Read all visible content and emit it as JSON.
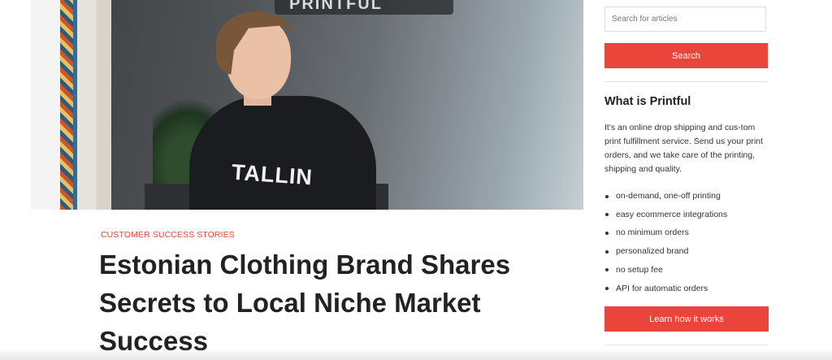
{
  "article": {
    "category": "CUSTOMER SUCCESS STORIES",
    "title": "Estonian Clothing Brand Shares Secrets to Local Niche Market Success",
    "hero": {
      "sign_text": "PRINTFUL",
      "shirt_text": "TALLIN"
    }
  },
  "sidebar": {
    "search": {
      "placeholder": "Search for articles",
      "button_label": "Search"
    },
    "info": {
      "title": "What is Printful",
      "description": "It's an online drop shipping and cus-tom print fulfillment service. Send us your print orders, and we take care of the printing, shipping and quality.",
      "features": [
        "on-demand, one-off printing",
        "easy ecommerce integrations",
        "no minimum orders",
        "personalized brand",
        "no setup fee",
        "API for automatic orders"
      ],
      "cta_label": "Learn how it works"
    }
  },
  "colors": {
    "accent": "#e9453b",
    "category": "#e4473a",
    "text": "#222222"
  }
}
